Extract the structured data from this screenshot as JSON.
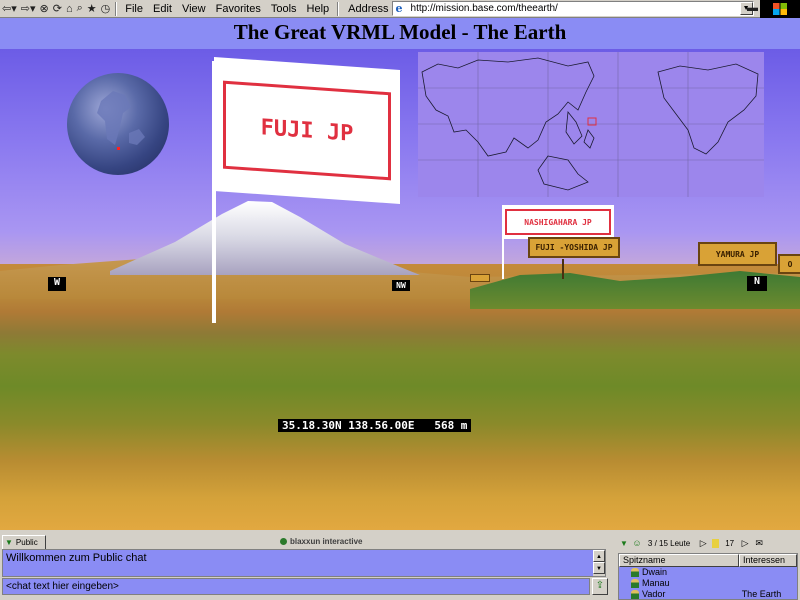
{
  "browser": {
    "menu": [
      "File",
      "Edit",
      "View",
      "Favorites",
      "Tools",
      "Help"
    ],
    "address_label": "Address",
    "url": "http://mission.base.com/theearth/"
  },
  "page": {
    "title": "The Great VRML Model - The Earth"
  },
  "scene": {
    "direction_labels": {
      "west": "W",
      "northwest": "NW",
      "north": "N"
    },
    "flags": {
      "main": "FUJI JP",
      "second": "NASHIGAHARA JP"
    },
    "signboards": {
      "fuji_yoshida": "FUJI -YOSHIDA JP",
      "yamura": "YAMURA JP",
      "edge": "O"
    },
    "coordinates": "35.18.30N 138.56.00E   568 m"
  },
  "chat": {
    "tab_label": "Public",
    "brand": "blaxxun interactive",
    "welcome_message": "Willkommen zum Public chat",
    "input_placeholder": "<chat text hier eingeben>"
  },
  "people": {
    "count_label": "3 / 15 Leute",
    "counter": "17",
    "columns": {
      "name": "Spitzname",
      "interests": "Interessen"
    },
    "users": [
      {
        "name": "Dwain",
        "interests": ""
      },
      {
        "name": "Manau",
        "interests": ""
      },
      {
        "name": "Vador",
        "interests": "The Earth"
      }
    ]
  },
  "colors": {
    "banner_bg": "#8a8cf4",
    "chat_bg": "#8a8cf4",
    "flag_red": "#e03040",
    "signboard": "#d9a236"
  }
}
